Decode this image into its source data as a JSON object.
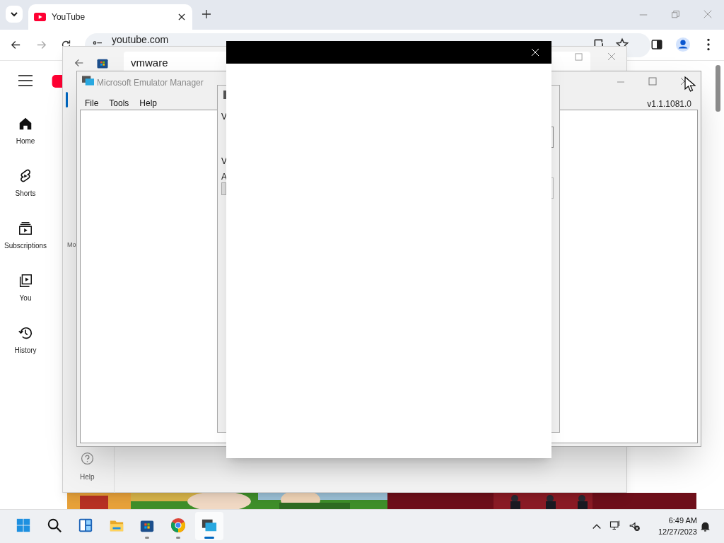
{
  "browser": {
    "tabs": [
      {
        "title": "YouTube",
        "selected": true
      }
    ],
    "address": "youtube.com"
  },
  "youtube_sidebar": {
    "items": [
      {
        "kind": "home",
        "label": "Home"
      },
      {
        "kind": "shorts",
        "label": "Shorts"
      },
      {
        "kind": "subscriptions",
        "label": "Subscriptions"
      },
      {
        "kind": "you",
        "label": "You"
      },
      {
        "kind": "history",
        "label": "History"
      }
    ]
  },
  "store_window": {
    "search_value": "vmware",
    "nav_label": "Mo",
    "help_label": "Help"
  },
  "emulator_manager": {
    "title": "Microsoft Emulator Manager",
    "menu": [
      "File",
      "Tools",
      "Help"
    ],
    "version": "v1.1.1081.0"
  },
  "dialog": {
    "labels": [
      "V",
      "V",
      "A"
    ]
  },
  "taskbar": {
    "apps": [
      {
        "kind": "start",
        "running": false,
        "selected": false
      },
      {
        "kind": "search",
        "running": false,
        "selected": false
      },
      {
        "kind": "widgets",
        "running": false,
        "selected": false
      },
      {
        "kind": "explorer",
        "running": false,
        "selected": false
      },
      {
        "kind": "store",
        "running": true,
        "selected": false
      },
      {
        "kind": "chrome",
        "running": true,
        "selected": false
      },
      {
        "kind": "emulator",
        "running": true,
        "selected": true
      }
    ],
    "time": "6:49 AM",
    "date": "12/27/2023"
  }
}
